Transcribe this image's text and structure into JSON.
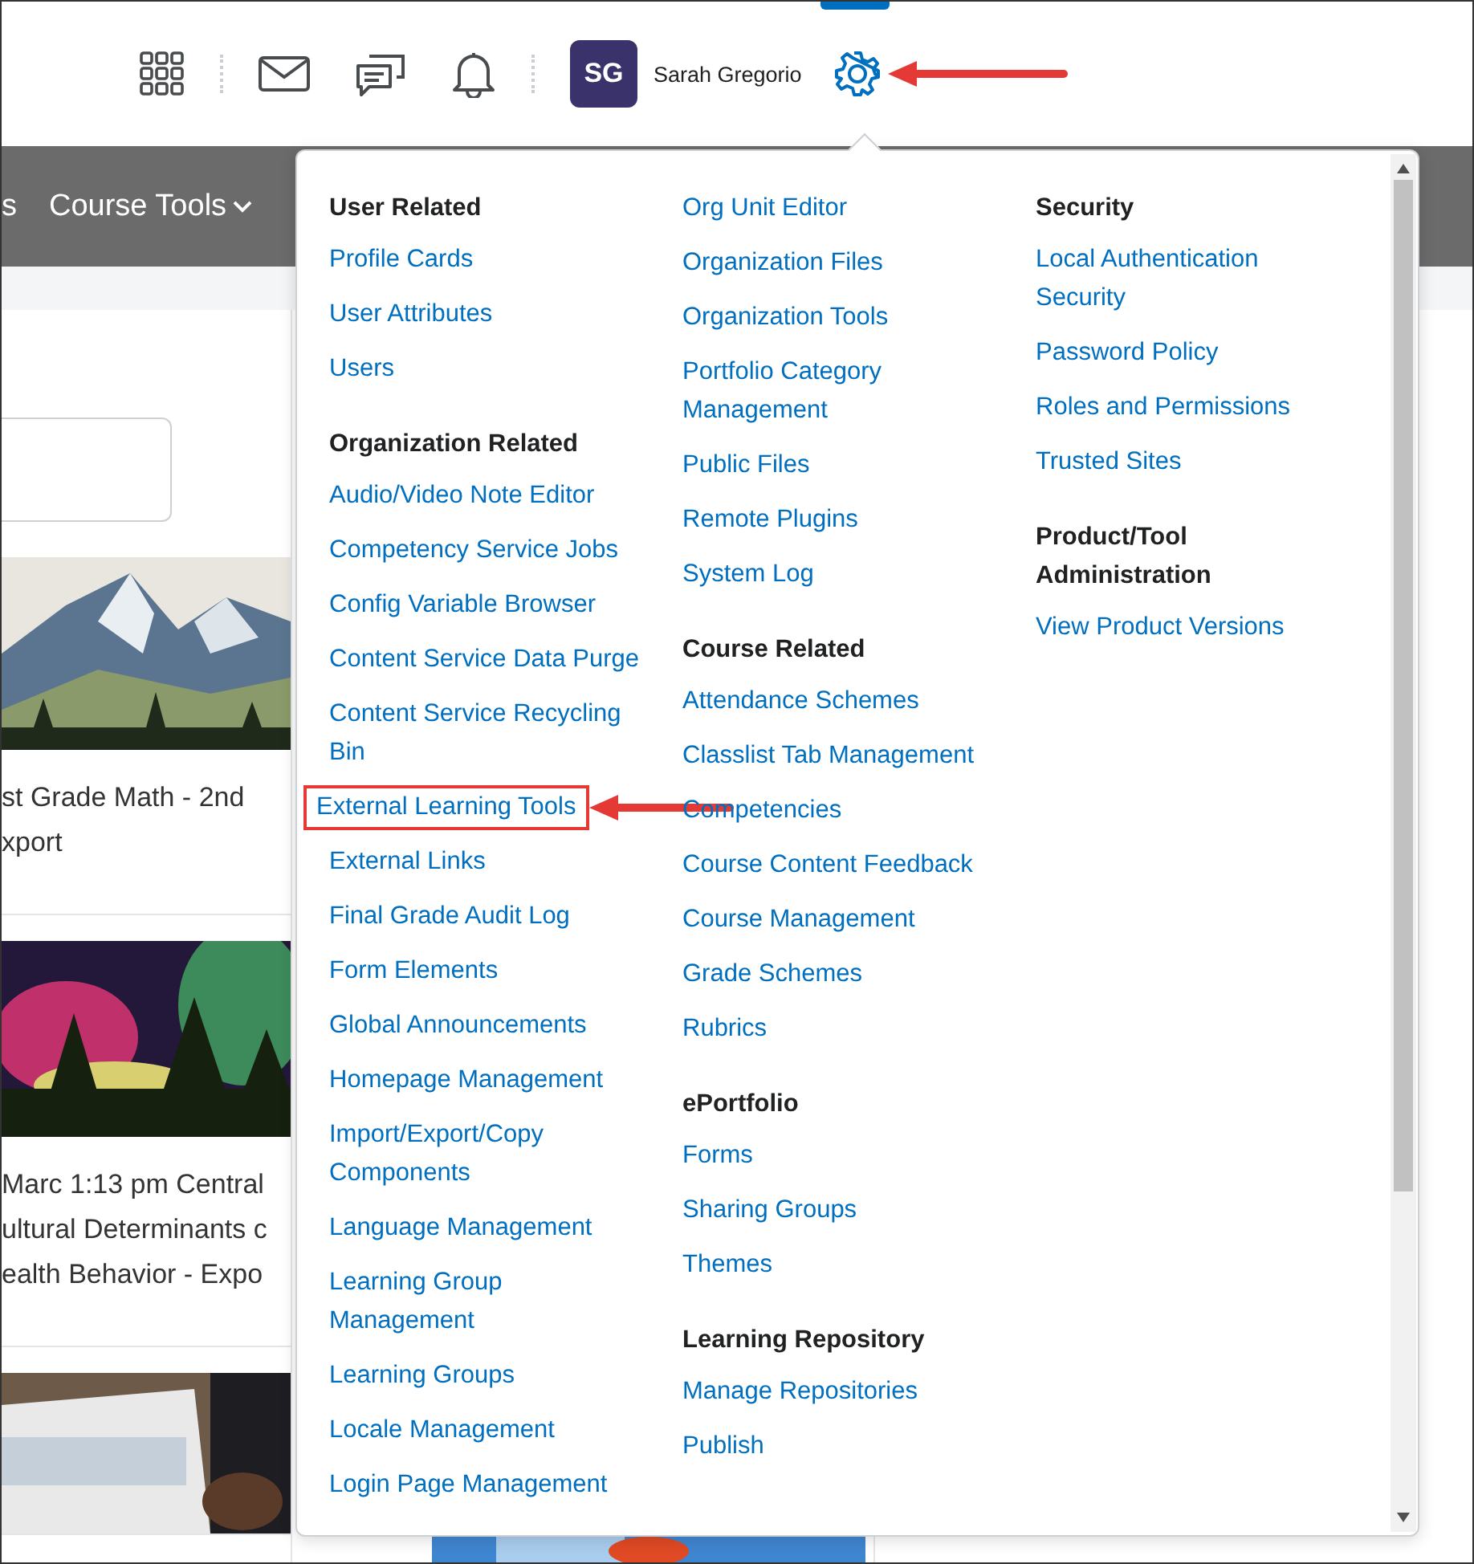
{
  "header": {
    "user": {
      "initials": "SG",
      "name": "Sarah Gregorio"
    },
    "gear_highlighted": true
  },
  "navbar": {
    "items": [
      {
        "label": "s",
        "menu": false
      },
      {
        "label": "Course Tools",
        "menu": true
      }
    ]
  },
  "cards": [
    {
      "lines": [
        "st Grade Math - 2nd",
        "xport"
      ]
    },
    {
      "lines": [
        "Marc 1:13 pm Central",
        "ultural Determinants c",
        "ealth Behavior - Expo"
      ]
    },
    {
      "kind": "picture"
    }
  ],
  "admin_menu": {
    "columns": [
      {
        "sections": [
          {
            "heading": "User Related",
            "links": [
              {
                "label": "Profile Cards",
                "highlighted": false
              },
              {
                "label": "User Attributes",
                "highlighted": false
              },
              {
                "label": "Users",
                "highlighted": false
              }
            ]
          },
          {
            "heading": "Organization Related",
            "links": [
              {
                "label": "Audio/Video Note Editor",
                "highlighted": false
              },
              {
                "label": "Competency Service Jobs",
                "highlighted": false
              },
              {
                "label": "Config Variable Browser",
                "highlighted": false
              },
              {
                "label": "Content Service Data Purge",
                "highlighted": false
              },
              {
                "label": "Content Service Recycling Bin",
                "highlighted": false
              },
              {
                "label": "External Learning Tools",
                "highlighted": true
              },
              {
                "label": "External Links",
                "highlighted": false
              },
              {
                "label": "Final Grade Audit Log",
                "highlighted": false
              },
              {
                "label": "Form Elements",
                "highlighted": false
              },
              {
                "label": "Global Announcements",
                "highlighted": false
              },
              {
                "label": "Homepage Management",
                "highlighted": false
              },
              {
                "label": "Import/Export/Copy Components",
                "highlighted": false
              },
              {
                "label": "Language Management",
                "highlighted": false
              },
              {
                "label": "Learning Group Management",
                "highlighted": false
              },
              {
                "label": "Learning Groups",
                "highlighted": false
              },
              {
                "label": "Locale Management",
                "highlighted": false
              },
              {
                "label": "Login Page Management",
                "highlighted": false
              }
            ]
          }
        ]
      },
      {
        "sections": [
          {
            "links": [
              {
                "label": "Org Unit Editor",
                "highlighted": false
              },
              {
                "label": "Organization Files",
                "highlighted": false
              },
              {
                "label": "Organization Tools",
                "highlighted": false
              },
              {
                "label": "Portfolio Category Management",
                "highlighted": false
              },
              {
                "label": "Public Files",
                "highlighted": false
              },
              {
                "label": "Remote Plugins",
                "highlighted": false
              },
              {
                "label": "System Log",
                "highlighted": false
              }
            ]
          },
          {
            "heading": "Course Related",
            "links": [
              {
                "label": "Attendance Schemes",
                "highlighted": false
              },
              {
                "label": "Classlist Tab Management",
                "highlighted": false
              },
              {
                "label": "Competencies",
                "highlighted": false
              },
              {
                "label": "Course Content Feedback",
                "highlighted": false
              },
              {
                "label": "Course Management",
                "highlighted": false
              },
              {
                "label": "Grade Schemes",
                "highlighted": false
              },
              {
                "label": "Rubrics",
                "highlighted": false
              }
            ]
          },
          {
            "heading": "ePortfolio",
            "links": [
              {
                "label": "Forms",
                "highlighted": false
              },
              {
                "label": "Sharing Groups",
                "highlighted": false
              },
              {
                "label": "Themes",
                "highlighted": false
              }
            ]
          },
          {
            "heading": "Learning Repository",
            "links": [
              {
                "label": "Manage Repositories",
                "highlighted": false
              },
              {
                "label": "Publish",
                "highlighted": false
              }
            ]
          }
        ]
      },
      {
        "sections": [
          {
            "heading": "Security",
            "links": [
              {
                "label": "Local Authentication Security",
                "highlighted": false
              },
              {
                "label": "Password Policy",
                "highlighted": false
              },
              {
                "label": "Roles and Permissions",
                "highlighted": false
              },
              {
                "label": "Trusted Sites",
                "highlighted": false
              }
            ]
          },
          {
            "heading": "Product/Tool Administration",
            "links": [
              {
                "label": "View Product Versions",
                "highlighted": false
              }
            ]
          }
        ]
      }
    ]
  }
}
